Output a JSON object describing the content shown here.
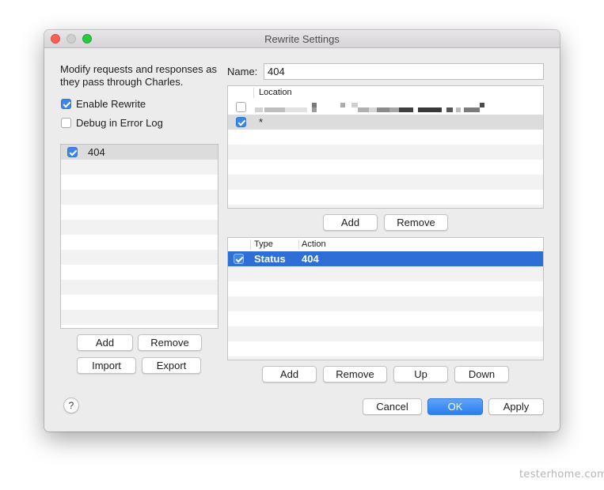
{
  "window": {
    "title": "Rewrite Settings"
  },
  "left": {
    "description": "Modify requests and responses as they pass through Charles.",
    "enable_rewrite": {
      "label": "Enable Rewrite",
      "checked": true
    },
    "debug_log": {
      "label": "Debug in Error Log",
      "checked": false
    },
    "sets": [
      {
        "name": "404",
        "checked": true
      }
    ],
    "buttons": {
      "add": "Add",
      "remove": "Remove",
      "import": "Import",
      "export": "Export"
    }
  },
  "right": {
    "name_label": "Name:",
    "name_value": "404",
    "locations": {
      "header": "Location",
      "rows": [
        {
          "checked": false,
          "value": "",
          "obscured": true
        },
        {
          "checked": true,
          "value": "*"
        }
      ],
      "buttons": {
        "add": "Add",
        "remove": "Remove"
      }
    },
    "rules": {
      "headers": {
        "type": "Type",
        "action": "Action"
      },
      "rows": [
        {
          "checked": true,
          "type": "Status",
          "action": "404",
          "selected": true
        }
      ],
      "buttons": {
        "add": "Add",
        "remove": "Remove",
        "up": "Up",
        "down": "Down"
      }
    }
  },
  "footer": {
    "help": "?",
    "cancel": "Cancel",
    "ok": "OK",
    "apply": "Apply"
  },
  "watermark": "testerhome.com",
  "colors": {
    "accent": "#2c7ef0",
    "selection": "#2d6fd6",
    "window_bg": "#ececec"
  }
}
